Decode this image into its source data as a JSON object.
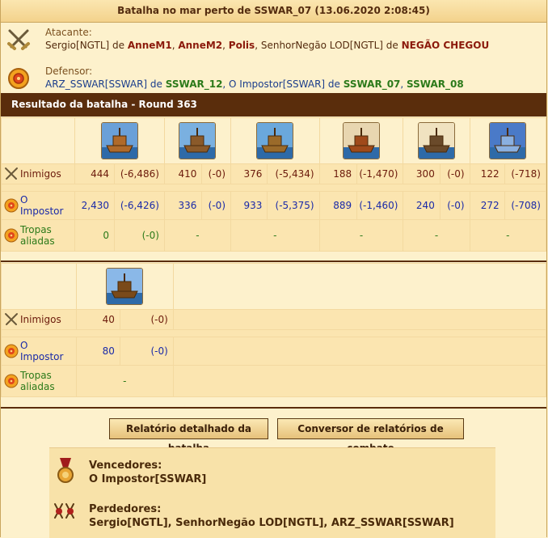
{
  "report": {
    "title": "Batalha no mar perto de SSWAR_07 (13.06.2020 2:08:45)"
  },
  "attacker": {
    "label": "Atacante:",
    "line": [
      {
        "text": "Sergio[NGTL] de ",
        "bold": false
      },
      {
        "text": "AnneM1",
        "bold": true
      },
      {
        "text": ", ",
        "bold": false
      },
      {
        "text": "AnneM2",
        "bold": true
      },
      {
        "text": ", ",
        "bold": false
      },
      {
        "text": "Polis",
        "bold": true
      },
      {
        "text": ", SenhorNegão LOD[NGTL] de ",
        "bold": false
      },
      {
        "text": "NEGÃO CHEGOU",
        "bold": true
      }
    ]
  },
  "defender": {
    "label": "Defensor:",
    "line": [
      {
        "text": "ARZ_SSWAR[SSWAR] de ",
        "bold": false
      },
      {
        "text": "SSWAR_12",
        "bold": true
      },
      {
        "text": ", O Impostor[SSWAR] de ",
        "bold": false
      },
      {
        "text": "SSWAR_07",
        "bold": true
      },
      {
        "text": ", ",
        "bold": false
      },
      {
        "text": "SSWAR_08",
        "bold": true
      }
    ]
  },
  "round_header": "Resultado da batalha - Round 363",
  "table1": {
    "units": [
      "ram-ship",
      "fire-ship",
      "ballista-ship",
      "catapult-ship",
      "mortar-ship",
      "paddle-steamer"
    ],
    "rows": [
      {
        "label": "Inimigos",
        "color": "red",
        "cells": [
          [
            "444",
            "(-6,486)"
          ],
          [
            "410",
            "(-0)"
          ],
          [
            "376",
            "(-5,434)"
          ],
          [
            "188",
            "(-1,470)"
          ],
          [
            "300",
            "(-0)"
          ],
          [
            "122",
            "(-718)"
          ]
        ]
      },
      {
        "label": "O Impostor",
        "color": "blue",
        "cells": [
          [
            "2,430",
            "(-6,426)"
          ],
          [
            "336",
            "(-0)"
          ],
          [
            "933",
            "(-5,375)"
          ],
          [
            "889",
            "(-1,460)"
          ],
          [
            "240",
            "(-0)"
          ],
          [
            "272",
            "(-708)"
          ]
        ]
      },
      {
        "label": "Tropas aliadas",
        "color": "green",
        "cells": [
          [
            "0",
            "(-0)"
          ],
          [
            "-",
            ""
          ],
          [
            "-",
            ""
          ],
          [
            "-",
            ""
          ],
          [
            "-",
            ""
          ],
          [
            "-",
            ""
          ]
        ]
      }
    ]
  },
  "table2": {
    "units": [
      "diving-boat"
    ],
    "rows": [
      {
        "label": "Inimigos",
        "color": "red",
        "cells": [
          [
            "40",
            "(-0)"
          ]
        ]
      },
      {
        "label": "O Impostor",
        "color": "blue",
        "cells": [
          [
            "80",
            "(-0)"
          ]
        ]
      },
      {
        "label": "Tropas aliadas",
        "color": "green",
        "cells": [
          [
            "-",
            ""
          ]
        ]
      }
    ]
  },
  "buttons": {
    "detailed": "Relatório detalhado da batalha",
    "converter": "Conversor de relatórios de combate"
  },
  "result": {
    "winners_label": "Vencedores:",
    "winners": "O Impostor[SSWAR]",
    "losers_label": "Perdedores:",
    "losers": "Sergio[NGTL], SenhorNegão LOD[NGTL], ARZ_SSWAR[SSWAR]"
  },
  "colors": {
    "header_bg": "#5a2d0c",
    "panel_bg": "#fdf1cc",
    "accent_red": "#8b1a0b",
    "accent_green": "#2c7a1a",
    "accent_blue": "#1a2aa8"
  }
}
